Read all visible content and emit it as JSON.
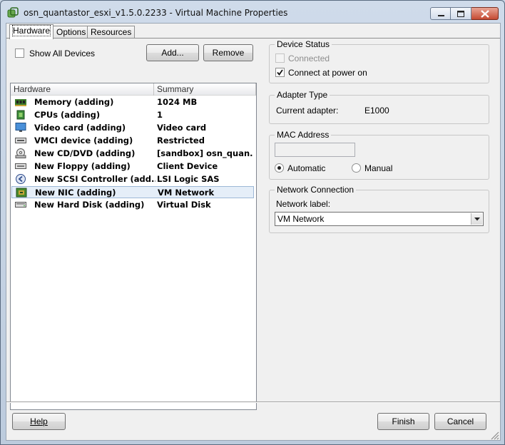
{
  "window": {
    "title": "osn_quantastor_esxi_v1.5.0.2233 - Virtual Machine Properties"
  },
  "tabs": [
    {
      "label": "Hardware",
      "active": true
    },
    {
      "label": "Options",
      "active": false
    },
    {
      "label": "Resources",
      "active": false
    }
  ],
  "hardware": {
    "show_all_devices_label": "Show All Devices",
    "show_all_devices_checked": false,
    "add_label": "Add...",
    "remove_label": "Remove",
    "columns": [
      "Hardware",
      "Summary"
    ],
    "rows": [
      {
        "icon": "memory-icon",
        "name": "Memory (adding)",
        "summary": "1024 MB"
      },
      {
        "icon": "cpu-icon",
        "name": "CPUs (adding)",
        "summary": "1"
      },
      {
        "icon": "monitor-icon",
        "name": "Video card  (adding)",
        "summary": "Video card"
      },
      {
        "icon": "vmci-icon",
        "name": "VMCI device (adding)",
        "summary": "Restricted"
      },
      {
        "icon": "cd-dvd-icon",
        "name": "New CD/DVD (adding)",
        "summary": "[sandbox] osn_quan..."
      },
      {
        "icon": "floppy-icon",
        "name": "New Floppy (adding)",
        "summary": "Client Device"
      },
      {
        "icon": "scsi-controller-icon",
        "name": "New SCSI Controller (add...",
        "summary": "LSI Logic SAS"
      },
      {
        "icon": "network-card-icon",
        "name": "New NIC (adding)",
        "summary": "VM Network",
        "selected": true
      },
      {
        "icon": "hard-disk-icon",
        "name": "New Hard Disk (adding)",
        "summary": "Virtual Disk"
      }
    ]
  },
  "device_status": {
    "title": "Device Status",
    "connected_label": "Connected",
    "connected_checked": false,
    "connect_power_on_label": "Connect at power on",
    "connect_power_on_checked": true
  },
  "adapter_type": {
    "title": "Adapter Type",
    "current_label": "Current adapter:",
    "current_value": "E1000"
  },
  "mac_address": {
    "title": "MAC Address",
    "value": "",
    "automatic_label": "Automatic",
    "manual_label": "Manual",
    "selected": "Automatic"
  },
  "network_connection": {
    "title": "Network Connection",
    "label": "Network label:",
    "value": "VM Network"
  },
  "footer": {
    "help_label": "Help",
    "finish_label": "Finish",
    "cancel_label": "Cancel"
  }
}
